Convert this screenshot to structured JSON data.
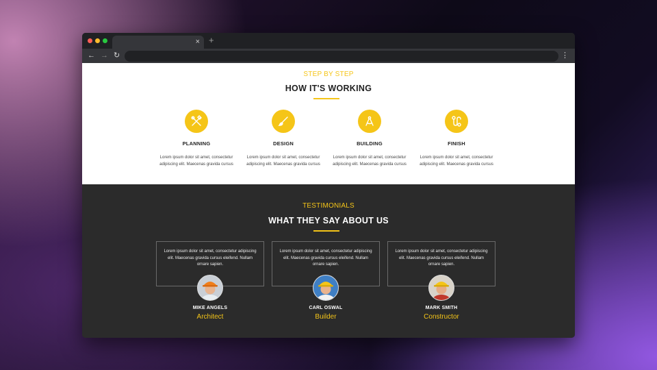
{
  "colors": {
    "accent": "#f5c518",
    "dark_section": "#2b2b2b",
    "browser_chrome": "#35363a",
    "dot_red": "#ff5f57",
    "dot_yellow": "#febc2e",
    "dot_green": "#28c840"
  },
  "browser": {
    "tab_close_icon": "×",
    "new_tab_icon": "+",
    "back_icon": "←",
    "forward_icon": "→",
    "reload_icon": "↻",
    "menu_icon": "⋮"
  },
  "steps_section": {
    "eyebrow": "STEP BY STEP",
    "title": "HOW IT'S WORKING",
    "steps": [
      {
        "icon": "tools-icon",
        "title": "PLANNING",
        "text": "Lorem ipsum dolor sit amet, consectetur adipiscing elit. Maecenas gravida cursus"
      },
      {
        "icon": "brush-icon",
        "title": "DESIGN",
        "text": "Lorem ipsum dolor sit amet, consectetur adipiscing elit. Maecenas gravida cursus"
      },
      {
        "icon": "compass-icon",
        "title": "BUILDING",
        "text": "Lorem ipsum dolor sit amet, consectetur adipiscing elit. Maecenas gravida cursus"
      },
      {
        "icon": "path-icon",
        "title": "FINISH",
        "text": "Lorem ipsum dolor sit amet, consectetur adipiscing elit. Maecenas gravida cursus"
      }
    ]
  },
  "testimonials": {
    "eyebrow": "TESTIMONIALS",
    "title": "WHAT THEY SAY ABOUT US",
    "items": [
      {
        "quote": "Lorem ipsum dolor sit amet, consectetur adipiscing elit. Maecenas gravida cursus eleifend. Nullam ornare sapien.",
        "name": "MIKE ANGELS",
        "role": "Architect"
      },
      {
        "quote": "Lorem ipsum dolor sit amet, consectetur adipiscing elit. Maecenas gravida cursus eleifend. Nullam ornare sapien.",
        "name": "CARL OSWAL",
        "role": "Builder"
      },
      {
        "quote": "Lorem ipsum dolor sit amet, consectetur adipiscing elit. Maecenas gravida cursus eleifend. Nullam ornare sapien.",
        "name": "MARK SMITH",
        "role": "Constructor"
      }
    ]
  }
}
